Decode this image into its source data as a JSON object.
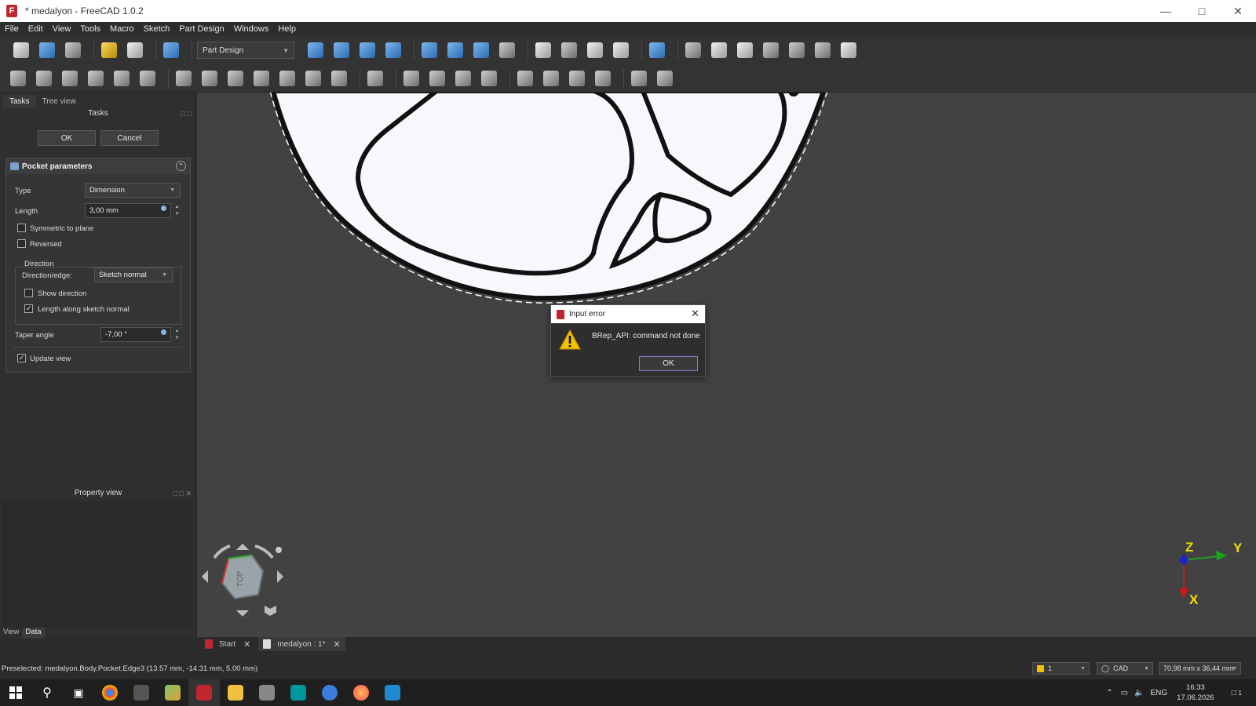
{
  "window": {
    "title": "* medalyon - FreeCAD 1.0.2",
    "app_logo": "F"
  },
  "menu": [
    "File",
    "Edit",
    "View",
    "Tools",
    "Macro",
    "Sketch",
    "Part Design",
    "Windows",
    "Help"
  ],
  "toolbar": {
    "workbench": "Part Design"
  },
  "left_panel": {
    "tabs": [
      "Tasks",
      "Tree view"
    ],
    "tasks_header": "Tasks",
    "ok_label": "OK",
    "cancel_label": "Cancel",
    "pocket": {
      "title": "Pocket parameters",
      "type_label": "Type",
      "type_value": "Dimension",
      "length_label": "Length",
      "length_value": "3,00 mm",
      "symmetric_label": "Symmetric to plane",
      "symmetric_checked": false,
      "reversed_label": "Reversed",
      "reversed_checked": false,
      "direction_group": "Direction",
      "direction_edge_label": "Direction/edge:",
      "direction_edge_value": "Sketch normal",
      "show_direction_label": "Show direction",
      "show_direction_checked": false,
      "length_along_label": "Length along sketch normal",
      "length_along_checked": true,
      "taper_label": "Taper angle",
      "taper_value": "-7,00 °",
      "update_view_label": "Update view",
      "update_view_checked": true
    },
    "property_view": "Property view",
    "bottom_tabs": [
      "View",
      "Data"
    ]
  },
  "navcube": {
    "face": "TOP"
  },
  "axes": {
    "z": "Z",
    "y": "Y",
    "x": "X"
  },
  "doc_tabs": [
    {
      "label": "Start"
    },
    {
      "label": "medalyon : 1*"
    }
  ],
  "dialog": {
    "title": "Input error",
    "message": "BRep_API: command not done",
    "ok_label": "OK"
  },
  "status": {
    "preselected": "Preselected: medalyon.Body.Pocket.Edge3 (13.57 mm, -14.31 mm, 5.00 mm)",
    "layer": "1",
    "nav_style": "CAD",
    "dimensions": "70,98 mm x 36,44 mm"
  },
  "taskbar": {
    "lang": "ENG",
    "time": "16:33",
    "date": "17.06.2026",
    "notifications": "1"
  },
  "colors": {
    "dialog_ok_border": "#8e79c6",
    "freecad_red": "#c0262d",
    "axis_x": "#d01818",
    "axis_y": "#1ea01e",
    "axis_z": "#2020d0"
  }
}
